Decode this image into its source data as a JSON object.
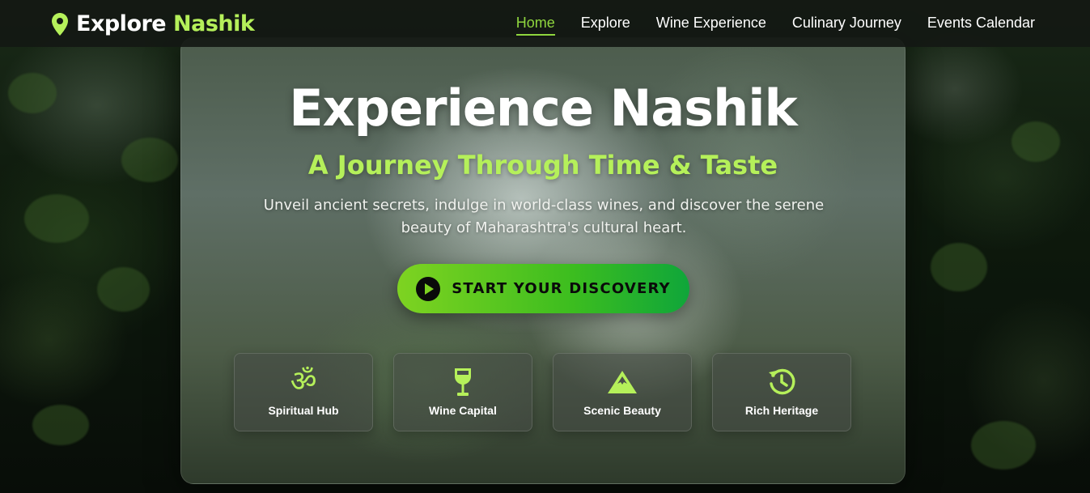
{
  "nav": {
    "brand_prefix": "Explore",
    "brand_accent": "Nashik",
    "links": [
      {
        "label": "Home",
        "active": true
      },
      {
        "label": "Explore",
        "active": false
      },
      {
        "label": "Wine Experience",
        "active": false
      },
      {
        "label": "Culinary Journey",
        "active": false
      },
      {
        "label": "Events Calendar",
        "active": false
      }
    ]
  },
  "hero": {
    "title": "Experience Nashik",
    "subtitle": "A Journey Through Time & Taste",
    "description": "Unveil ancient secrets, indulge in world-class wines, and discover the serene beauty of Maharashtra's cultural heart.",
    "cta_label": "START YOUR DISCOVERY"
  },
  "features": [
    {
      "label": "Spiritual Hub",
      "icon": "om-icon"
    },
    {
      "label": "Wine Capital",
      "icon": "wine-glass-icon"
    },
    {
      "label": "Scenic Beauty",
      "icon": "mountain-icon"
    },
    {
      "label": "Rich Heritage",
      "icon": "history-icon"
    }
  ],
  "colors": {
    "accent": "#b5f05a",
    "active_link": "#8fd63e",
    "cta_start": "#7ed321",
    "cta_end": "#0fa63a",
    "nav_bg": "#141814"
  }
}
